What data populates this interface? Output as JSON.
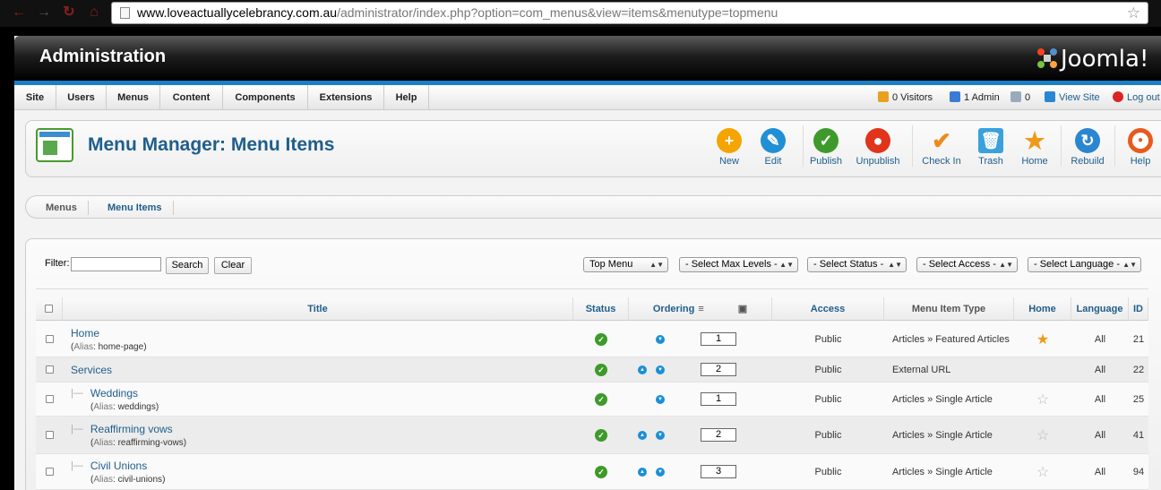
{
  "browser": {
    "url_host": "www.loveactuallycelebrancy.com.au",
    "url_path": "/administrator/index.php?option=com_menus&view=items&menutype=topmenu"
  },
  "header": {
    "title": "Administration",
    "logo_text": "Joomla!"
  },
  "menubar": {
    "items": [
      "Site",
      "Users",
      "Menus",
      "Content",
      "Components",
      "Extensions",
      "Help"
    ],
    "status": {
      "visitors": "0 Visitors",
      "admin": "1 Admin",
      "messages": "0",
      "view_site": "View Site",
      "logout": "Log out"
    }
  },
  "toolbar": {
    "title": "Menu Manager: Menu Items",
    "buttons": [
      {
        "label": "New",
        "color": "#f5a400",
        "icon": "plus-icon"
      },
      {
        "label": "Edit",
        "color": "#1f8fd6",
        "icon": "pencil-icon"
      },
      {
        "label": "Publish",
        "color": "#3e9a2a",
        "icon": "check-icon"
      },
      {
        "label": "Unpublish",
        "color": "#e2331b",
        "icon": "circle-icon"
      },
      {
        "label": "Check In",
        "color": "#ee8a1c",
        "icon": "checkin-icon"
      },
      {
        "label": "Trash",
        "color": "#3aa1dc",
        "icon": "trash-icon"
      },
      {
        "label": "Home",
        "color": "#f09a1a",
        "icon": "star-icon"
      },
      {
        "label": "Rebuild",
        "color": "#2a86d1",
        "icon": "refresh-icon"
      },
      {
        "label": "Help",
        "color": "#e75a1e",
        "icon": "lifebuoy-icon"
      }
    ]
  },
  "submenu": {
    "items": [
      "Menus",
      "Menu Items"
    ]
  },
  "filter": {
    "label": "Filter:",
    "value": "",
    "search_label": "Search",
    "clear_label": "Clear",
    "selects": [
      "Top Menu",
      "- Select Max Levels -",
      "- Select Status -",
      "- Select Access -",
      "- Select Language -"
    ]
  },
  "table": {
    "headers": {
      "title": "Title",
      "status": "Status",
      "ordering": "Ordering",
      "access": "Access",
      "type": "Menu Item Type",
      "home": "Home",
      "language": "Language",
      "id": "ID"
    },
    "alias_label": "Alias",
    "rows": [
      {
        "title": "Home",
        "alias": "home-page",
        "level": 1,
        "up": false,
        "down": true,
        "order": "1",
        "access": "Public",
        "type": "Articles » Featured Articles",
        "home": true,
        "language": "All",
        "id": "21"
      },
      {
        "title": "Services",
        "alias": "",
        "level": 1,
        "up": true,
        "down": true,
        "order": "2",
        "access": "Public",
        "type": "External URL",
        "home": null,
        "language": "All",
        "id": "22"
      },
      {
        "title": "Weddings",
        "alias": "weddings",
        "level": 2,
        "up": false,
        "down": true,
        "order": "1",
        "access": "Public",
        "type": "Articles » Single Article",
        "home": false,
        "language": "All",
        "id": "25"
      },
      {
        "title": "Reaffirming vows",
        "alias": "reaffirming-vows",
        "level": 2,
        "up": true,
        "down": true,
        "order": "2",
        "access": "Public",
        "type": "Articles » Single Article",
        "home": false,
        "language": "All",
        "id": "41"
      },
      {
        "title": "Civil Unions",
        "alias": "civil-unions",
        "level": 2,
        "up": true,
        "down": true,
        "order": "3",
        "access": "Public",
        "type": "Articles » Single Article",
        "home": false,
        "language": "All",
        "id": "94"
      }
    ]
  }
}
